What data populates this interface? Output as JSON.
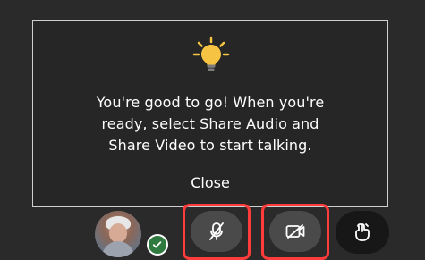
{
  "notice": {
    "message_lines": [
      "You're good to go! When you're",
      "ready, select Share Audio and",
      "Share Video to start talking."
    ],
    "close_label": "Close",
    "bulb_icon": "lightbulb-icon"
  },
  "toolbar": {
    "avatar_icon": "user-avatar",
    "status_icon": "checkmark-icon",
    "audio_icon": "microphone-off-icon",
    "video_icon": "camera-off-icon",
    "share_screen_icon": "share-screen-icon"
  },
  "colors": {
    "background": "#2a2a2a",
    "panel_border": "#cfcfcf",
    "highlight": "#ff3b3b",
    "control_bg": "#4a4a4a",
    "status_green": "#2f7b3f",
    "bulb_yellow": "#f6c343"
  }
}
